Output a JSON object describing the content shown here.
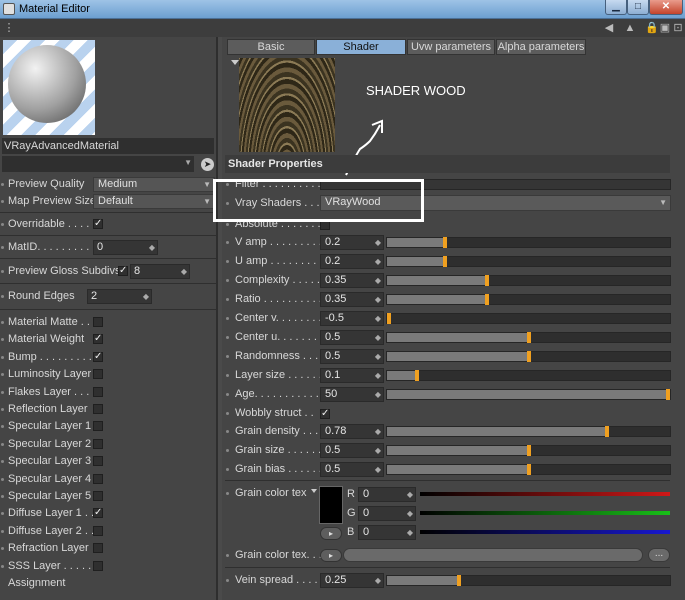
{
  "window": {
    "title": "Material Editor"
  },
  "material": {
    "name": "VRayAdvancedMaterial"
  },
  "left_rows": [
    {
      "label": "Preview Quality",
      "value": "Medium"
    },
    {
      "label": "Map Preview Size",
      "value": "Default"
    },
    {
      "label": "Overridable . . . . .",
      "checked": true
    },
    {
      "label": "MatID. . . . . . . . . .",
      "value": "0"
    },
    {
      "label": "Preview Gloss Subdivs",
      "checked": true,
      "value": "8"
    },
    {
      "label": "Round Edges",
      "value": "2"
    }
  ],
  "layers": [
    {
      "label": "Material Matte . . .",
      "checked": false
    },
    {
      "label": "Material Weight",
      "checked": true
    },
    {
      "label": "Bump . . . . . . . . . .",
      "checked": true
    },
    {
      "label": "Luminosity Layer",
      "checked": false
    },
    {
      "label": "Flakes Layer . . . . .",
      "checked": false
    },
    {
      "label": "Reflection Layer",
      "checked": false
    },
    {
      "label": "Specular Layer 1",
      "checked": false
    },
    {
      "label": "Specular Layer 2",
      "checked": false
    },
    {
      "label": "Specular Layer 3",
      "checked": false
    },
    {
      "label": "Specular Layer 4",
      "checked": false
    },
    {
      "label": "Specular Layer 5",
      "checked": false
    },
    {
      "label": "Diffuse Layer 1 . .",
      "checked": true
    },
    {
      "label": "Diffuse Layer 2 . .",
      "checked": false
    },
    {
      "label": "Refraction Layer",
      "checked": false
    },
    {
      "label": "SSS Layer . . . . . .",
      "checked": false
    },
    {
      "label": "Assignment"
    }
  ],
  "tabs": [
    "Basic",
    "Shader",
    "Uvw parameters",
    "Alpha parameters"
  ],
  "active_tab": "Shader",
  "annotation": {
    "text": "SHADER WOOD"
  },
  "shader": {
    "section_title": "Shader Properties",
    "filter_label": "Filter . . . . . . . . . .",
    "vray_shaders_label": "Vray Shaders . . .",
    "vray_shaders_value": "VRayWood",
    "absolute_label": "Absolute . . . . . . .",
    "params": [
      {
        "label": "V amp . . . . . . . . .",
        "value": "0.2",
        "level": 0.2
      },
      {
        "label": "U amp . . . . . . . . .",
        "value": "0.2",
        "level": 0.2
      },
      {
        "label": "Complexity . . . . .",
        "value": "0.35",
        "level": 0.35
      },
      {
        "label": "Ratio . . . . . . . . . .",
        "value": "0.35",
        "level": 0.35
      },
      {
        "label": "Center v. . . . . . . .",
        "value": "-0.5",
        "level": 0.0
      },
      {
        "label": "Center u. . . . . . . .",
        "value": "0.5",
        "level": 0.5
      },
      {
        "label": "Randomness . . . .",
        "value": "0.5",
        "level": 0.5
      },
      {
        "label": "Layer size . . . . . .",
        "value": "0.1",
        "level": 0.1
      },
      {
        "label": "Age. . . . . . . . . . . .",
        "value": "50",
        "level": 1.0
      }
    ],
    "wobbly_label": "Wobbly struct . .",
    "wobbly_checked": true,
    "grain_params": [
      {
        "label": "Grain density . . .",
        "value": "0.78",
        "level": 0.78
      },
      {
        "label": "Grain size . . . . . .",
        "value": "0.5",
        "level": 0.5
      },
      {
        "label": "Grain bias . . . . . .",
        "value": "0.5",
        "level": 0.5
      }
    ],
    "grain_color_label": "Grain color tex",
    "grain_rgb": [
      {
        "channel": "R",
        "value": "0",
        "color": "#d01818"
      },
      {
        "channel": "G",
        "value": "0",
        "color": "#18c018"
      },
      {
        "channel": "B",
        "value": "0",
        "color": "#1818d0"
      }
    ],
    "grain_color_tex_label": "Grain color tex. . .",
    "vein_spread": {
      "label": "Vein spread . . . . .",
      "value": "0.25",
      "level": 0.25
    }
  },
  "colors": {
    "accent": "#f0a020",
    "tab_active": "#8ab0d8",
    "panel": "#454545"
  }
}
